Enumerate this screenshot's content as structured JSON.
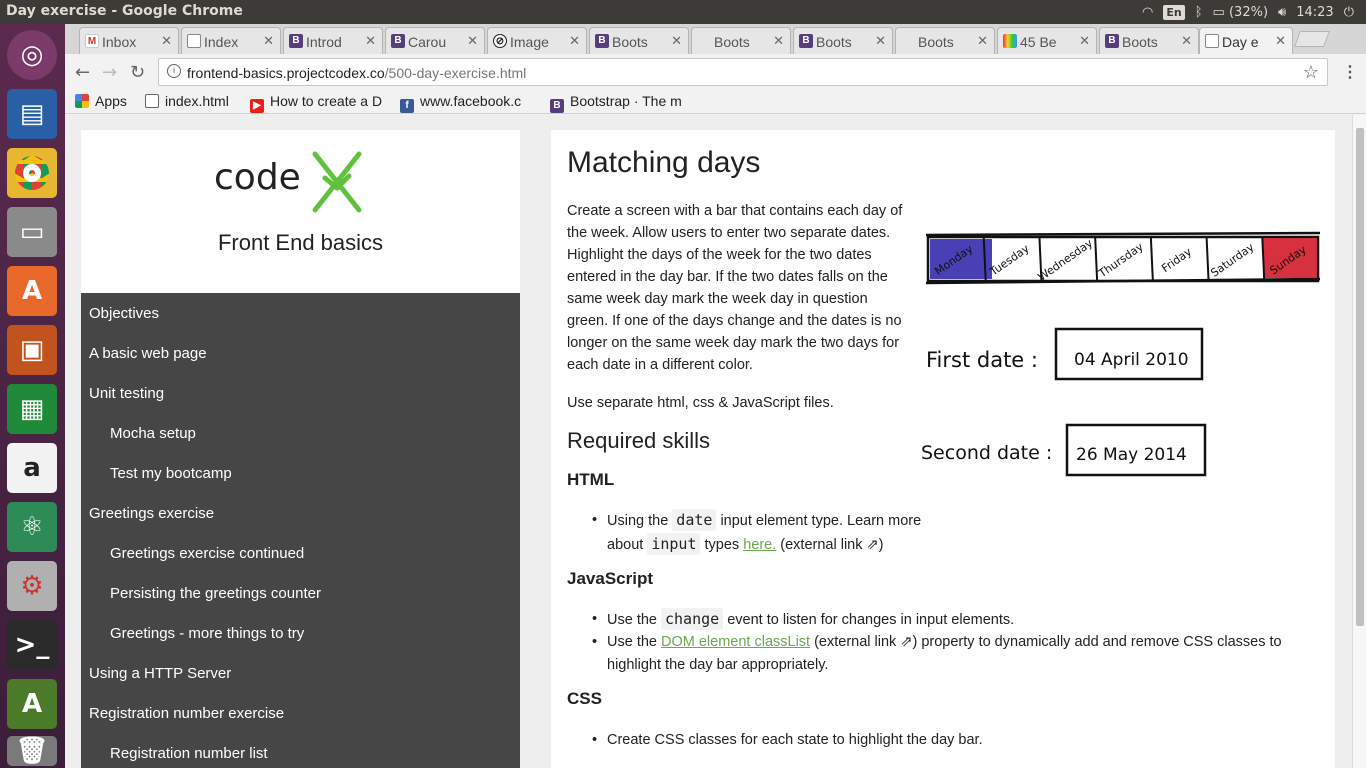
{
  "os": {
    "window_title": "Day exercise - Google Chrome",
    "lang": "En",
    "battery": "(32%)",
    "time": "14:23"
  },
  "tabs": [
    {
      "label": "Inbox",
      "icon": "gmail-icon"
    },
    {
      "label": "Index",
      "icon": "page-icon"
    },
    {
      "label": "Introd",
      "icon": "bootstrap-icon"
    },
    {
      "label": "Carou",
      "icon": "bootstrap-icon"
    },
    {
      "label": "Image",
      "icon": "image-icon"
    },
    {
      "label": "Boots",
      "icon": "bootstrap-icon"
    },
    {
      "label": "Boots",
      "icon": "none"
    },
    {
      "label": "Boots",
      "icon": "bootstrap-icon"
    },
    {
      "label": "Boots",
      "icon": "none"
    },
    {
      "label": "45 Be",
      "icon": "color-icon"
    },
    {
      "label": "Boots",
      "icon": "bootstrap-icon"
    },
    {
      "label": "Day e",
      "icon": "page-icon"
    }
  ],
  "address": {
    "host": "frontend-basics.projectcodex.co",
    "path": "/500-day-exercise.html"
  },
  "bookmarks": [
    {
      "label": "Apps"
    },
    {
      "label": "index.html"
    },
    {
      "label": "How to create a D"
    },
    {
      "label": "www.facebook.c"
    },
    {
      "label": "Bootstrap · The m"
    }
  ],
  "sidebar": {
    "logo_text": "code",
    "site_title": "Front End basics",
    "items": [
      {
        "label": "Objectives"
      },
      {
        "label": "A basic web page"
      },
      {
        "label": "Unit testing"
      },
      {
        "label": "Mocha setup"
      },
      {
        "label": "Test my bootcamp"
      },
      {
        "label": "Greetings exercise"
      },
      {
        "label": "Greetings exercise continued"
      },
      {
        "label": "Persisting the greetings counter"
      },
      {
        "label": "Greetings - more things to try"
      },
      {
        "label": "Using a HTTP Server"
      },
      {
        "label": "Registration number exercise"
      },
      {
        "label": "Registration number list"
      }
    ]
  },
  "content": {
    "title": "Matching days",
    "intro": "Create a screen with a bar that contains each day of the week. Allow users to enter two separate dates. Highlight the days of the week for the two dates entered in the day bar. If the two dates falls on the same week day mark the week day in question green. If one of the days change and the dates is no longer on the same week day mark the two days for each date in a different color.",
    "files_note": "Use separate html, css & JavaScript files.",
    "skills_heading": "Required skills",
    "html_heading": "HTML",
    "html_item": {
      "p1": "Using the ",
      "code1": "date",
      "p2": " input element type. Learn more about ",
      "code2": "input",
      "p3": " types ",
      "link": "here.",
      "p4": " (external link ⇗)"
    },
    "js_heading": "JavaScript",
    "js_item1": {
      "p1": "Use the ",
      "code": "change",
      "p2": " event to listen for changes in input elements."
    },
    "js_item2": {
      "p1": "Use the ",
      "link": "DOM element classList",
      "p2": " (external link ⇗) property to dynamically add and remove CSS classes to highlight the day bar appropriately."
    },
    "css_heading": "CSS",
    "css_item": "Create CSS classes for each state to highlight the day bar."
  },
  "sketch": {
    "days": [
      "Monday",
      "Tuesday",
      "Wednesday",
      "Thursday",
      "Friday",
      "Saturday",
      "Sunday"
    ],
    "first_label": "First date :",
    "first_value": "04 April 2010",
    "second_label": "Second date :",
    "second_value": "26 May 2014"
  },
  "colors": {
    "link": "#6aa84f",
    "sidebar_bg": "#464646",
    "logo_green": "#5fc23c"
  }
}
